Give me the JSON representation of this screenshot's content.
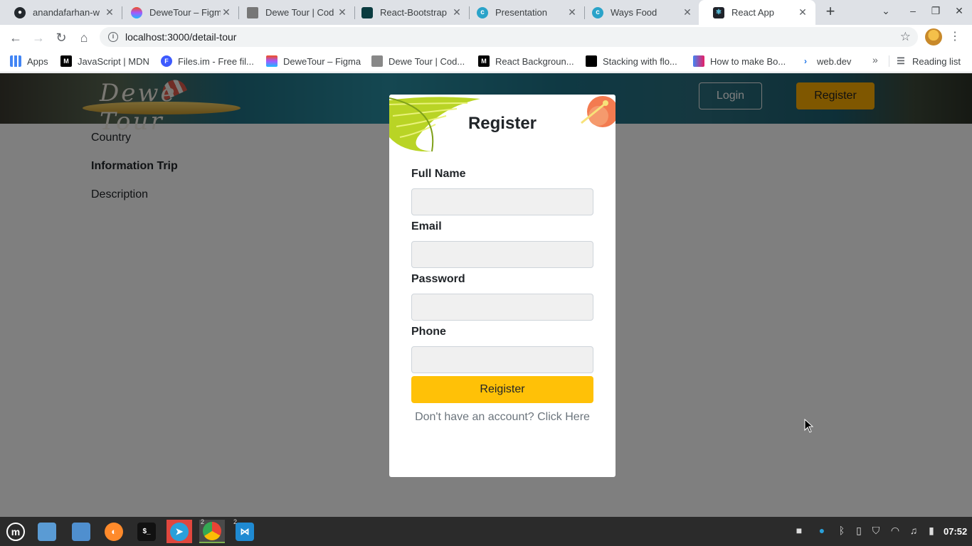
{
  "browser": {
    "tabs": [
      {
        "title": "anandafarhan-w",
        "icon": "github-icon"
      },
      {
        "title": "DeweTour – Figm",
        "icon": "figma-icon"
      },
      {
        "title": "Dewe Tour | Cod",
        "icon": "codepen-icon"
      },
      {
        "title": "React-Bootstrap",
        "icon": "react-bootstrap-icon"
      },
      {
        "title": "Presentation",
        "icon": "canva-icon"
      },
      {
        "title": "Ways Food",
        "icon": "canva-icon"
      },
      {
        "title": "React App",
        "icon": "react-icon"
      }
    ],
    "active_tab": "React App",
    "new_tab_symbol": "+",
    "url": "localhost:3000/detail-tour",
    "bookmarks": [
      {
        "label": "Apps",
        "icon": "apps-grid-icon"
      },
      {
        "label": "JavaScript | MDN",
        "icon": "mdn-icon"
      },
      {
        "label": "Files.im - Free fil...",
        "icon": "files-im-icon"
      },
      {
        "label": "DeweTour – Figma",
        "icon": "figma-icon"
      },
      {
        "label": "Dewe Tour | Cod...",
        "icon": "codepen-icon"
      },
      {
        "label": "React Backgroun...",
        "icon": "mdn-icon"
      },
      {
        "label": "Stacking with flo...",
        "icon": "bookmark-icon"
      },
      {
        "label": "How to make Bo...",
        "icon": "bookmark-icon"
      },
      {
        "label": "web.dev",
        "icon": "web-dev-icon"
      }
    ],
    "bookmarks_overflow": "»",
    "reading_list": "Reading list"
  },
  "site": {
    "logo_text": "Dewe Tour",
    "login_label": "Login",
    "register_label": "Register",
    "detail_items": [
      "Country",
      "Information Trip",
      "Description"
    ]
  },
  "modal": {
    "title": "Register",
    "fields": [
      {
        "label": "Full Name",
        "value": ""
      },
      {
        "label": "Email",
        "value": ""
      },
      {
        "label": "Password",
        "value": ""
      },
      {
        "label": "Phone",
        "value": ""
      }
    ],
    "submit_label": "Reigister",
    "switch_text": "Don't have an account? Click Here"
  },
  "taskbar": {
    "apps": [
      "mint-menu-icon",
      "files-icon",
      "folder-icon",
      "firefox-icon",
      "terminal-icon",
      "telegram-icon",
      "chrome-icon",
      "vscode-icon"
    ],
    "chrome_window_count": "2",
    "vscode_window_count": "2",
    "clock": "07:52",
    "colors": {
      "accent": "#ffaf00",
      "button": "#ffc107",
      "taskbar": "#2b2b2b"
    }
  }
}
